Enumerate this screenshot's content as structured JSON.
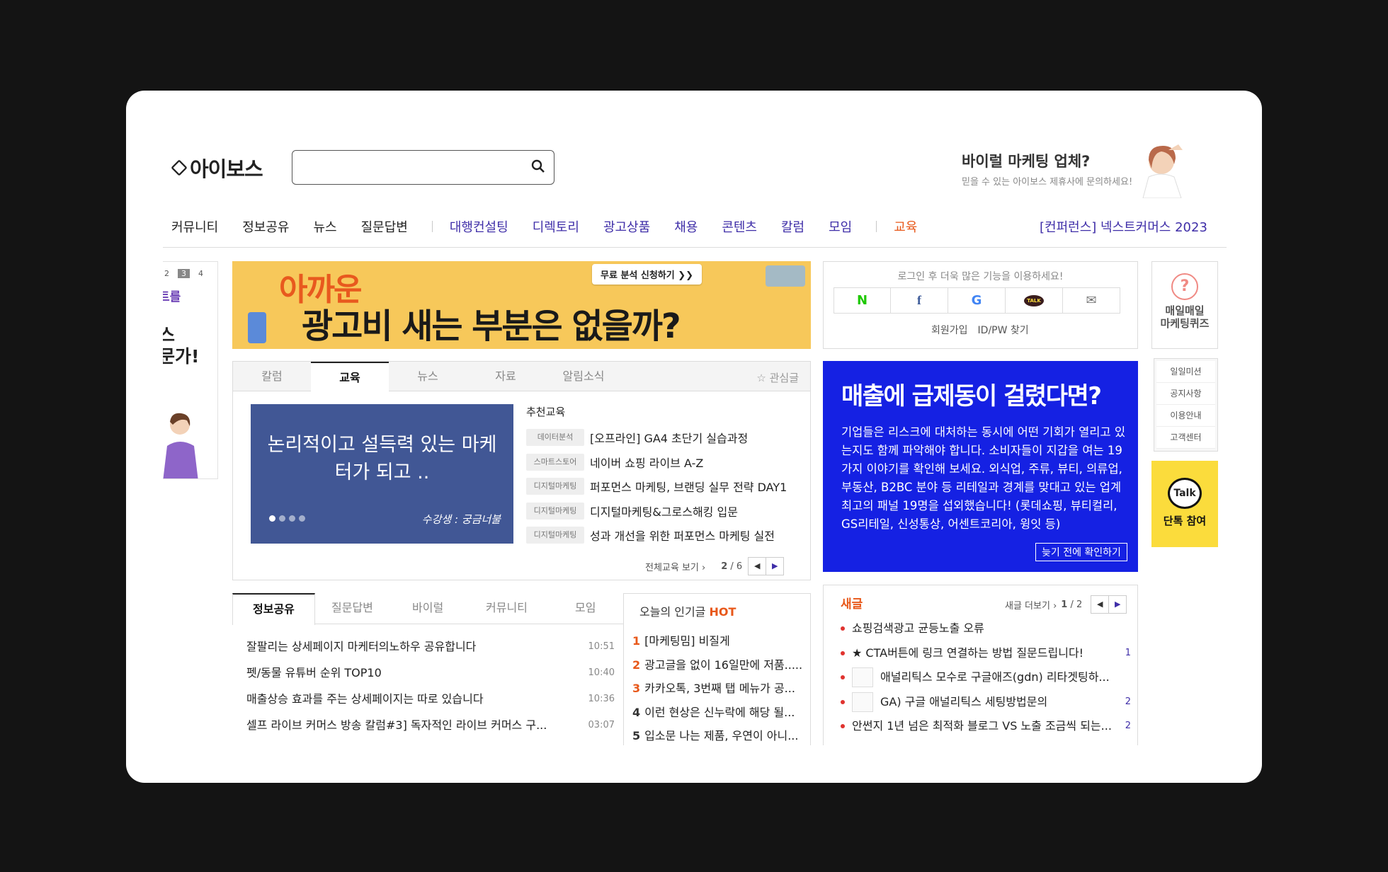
{
  "header": {
    "logo": "아이보스",
    "search_placeholder": "",
    "promo_title": "바이럴 마케팅 업체?",
    "promo_sub": "믿을 수 있는 아이보스 제휴사에 문의하세요!"
  },
  "nav": {
    "items": [
      "커뮤니티",
      "정보공유",
      "뉴스",
      "질문답변",
      "대행컨설팅",
      "디렉토리",
      "광고상품",
      "채용",
      "콘텐츠",
      "칼럼",
      "모임",
      "교육"
    ],
    "right": "[컨퍼런스] 넥스트커머스 2023"
  },
  "left_panel": {
    "pages": [
      "2",
      "3",
      "4"
    ],
    "text1": "트를",
    "text2": "스",
    "text3": "문가!"
  },
  "banner": {
    "line1": "아까운",
    "line2": "광고비 새는 부분은 없을까?",
    "cta": "무료 분석 신청하기 ❯❯"
  },
  "edu": {
    "tabs": [
      "칼럼",
      "교육",
      "뉴스",
      "자료",
      "알림소식"
    ],
    "interest": "☆ 관심글",
    "slide_text": "논리적이고 설득력 있는 마케터가 되고 ..",
    "slide_caption": "수강생 : 궁금너불",
    "rec_title": "추천교육",
    "items": [
      {
        "tag": "데이터분석",
        "title": "[오프라인] GA4 초단기 실습과정"
      },
      {
        "tag": "스마트스토어",
        "title": "네이버 쇼핑 라이브 A-Z"
      },
      {
        "tag": "디지털마케팅",
        "title": "퍼포먼스 마케팅, 브랜딩 실무 전략 DAY1"
      },
      {
        "tag": "디지털마케팅",
        "title": "디지털마케팅&그로스해킹 입문"
      },
      {
        "tag": "디지털마케팅",
        "title": "성과 개선을 위한 퍼포먼스 마케팅 실전"
      }
    ],
    "more": "전체교육 보기 ›",
    "page": "2",
    "total": "/ 6"
  },
  "info": {
    "tabs": [
      "정보공유",
      "질문답변",
      "바이럴",
      "커뮤니티",
      "모임"
    ],
    "rows": [
      {
        "title": "잘팔리는 상세페이지 마케터의노하우 공유합니다",
        "time": "10:51"
      },
      {
        "title": "펫/동물 유튜버 순위 TOP10",
        "time": "10:40"
      },
      {
        "title": "매출상승 효과를 주는 상세페이지는 따로 있습니다",
        "time": "10:36"
      },
      {
        "title": "셀프 라이브 커머스 방송 칼럼#3] 독자적인 라이브 커머스 구...",
        "time": "03:07"
      }
    ]
  },
  "hot": {
    "title": "오늘의 인기글",
    "badge": "HOT",
    "rows": [
      {
        "n": "1",
        "title": "[마케팅밈] 비질게"
      },
      {
        "n": "2",
        "title": "광고글을 없이 16일만에 저품....."
      },
      {
        "n": "3",
        "title": "카카오톡, 3번째 탭 메뉴가 공..."
      },
      {
        "n": "4",
        "title": "이런 현상은 신누락에 해당 될..."
      },
      {
        "n": "5",
        "title": "입소문 나는 제품, 우연이 아니..."
      }
    ]
  },
  "login": {
    "msg": "로그인 후 더욱 많은 기능을 이용하세요!",
    "sns": [
      "N",
      "f",
      "G",
      "TALK",
      "✉"
    ],
    "join": "회원가입",
    "find": "ID/PW 찾기"
  },
  "blue_ad": {
    "headline": "매출에 급제동이 걸렸다면?",
    "body": "기업들은 리스크에 대처하는 동시에 어떤 기회가 열리고 있는지도 함께 파악해야 합니다. 소비자들이 지갑을 여는 19가지 이야기를 확인해 보세요. 외식업, 주류, 뷰티, 의류업, 부동산, B2BC 분야 등 리테일과 경계를 맞대고 있는 업계 최고의 패널 19명을 섭외했습니다! (롯데쇼핑, 뷰티컬리, GS리테일, 신성통상, 어센트코리아, 윙잇 등)",
    "button": "늦기 전에 확인하기"
  },
  "new_posts": {
    "title": "새글",
    "more": "새글 더보기 ›",
    "page": "1",
    "total": "/ 2",
    "rows": [
      {
        "title": "쇼핑검색광고 균등노출 오류",
        "count": ""
      },
      {
        "title": "★ CTA버튼에 링크 연결하는 방법 질문드립니다!",
        "count": "1"
      },
      {
        "title": "애널리틱스 모수로 구글애즈(gdn) 리타겟팅하...",
        "count": ""
      },
      {
        "title": "GA) 구글 애널리틱스 세팅방법문의",
        "count": "2"
      },
      {
        "title": "안썬지 1년 넘은 최적화 블로그 VS 노출 조금씩 되는...",
        "count": "2"
      }
    ]
  },
  "side": {
    "quiz": "매일매일\n마케팅퀴즈",
    "menu": [
      "일일미션",
      "공지사항",
      "이용안내",
      "고객센터"
    ],
    "talk_icon": "Talk",
    "talk_label": "단톡 참여"
  }
}
